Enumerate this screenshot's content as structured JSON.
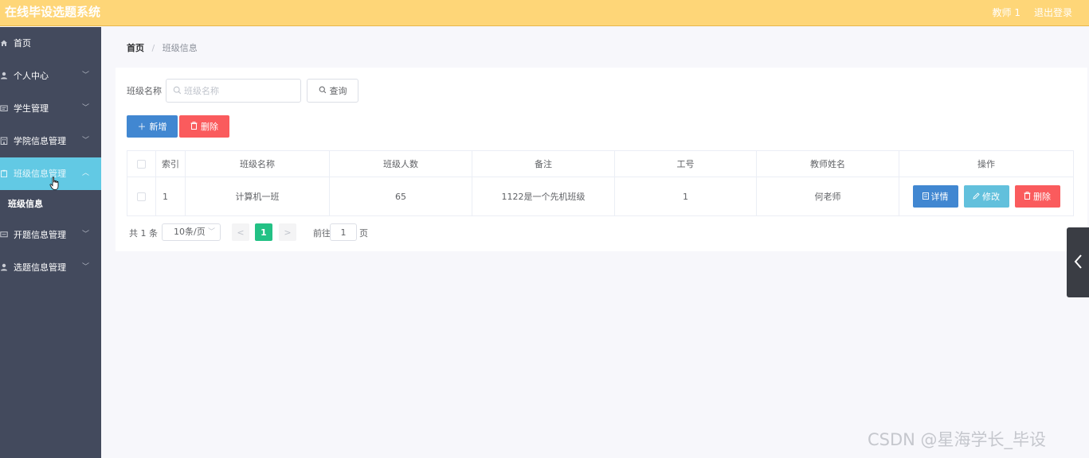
{
  "header": {
    "app_title": "在线毕设选题系统",
    "user": "教师 1",
    "logout": "退出登录"
  },
  "sidebar": {
    "items": [
      {
        "label": "首页",
        "icon": "home-icon",
        "arrow": ""
      },
      {
        "label": "个人中心",
        "icon": "user-icon",
        "arrow": "﹀"
      },
      {
        "label": "学生管理",
        "icon": "id-card-icon",
        "arrow": "﹀"
      },
      {
        "label": "学院信息管理",
        "icon": "building-icon",
        "arrow": "﹀"
      },
      {
        "label": "班级信息管理",
        "icon": "clipboard-icon",
        "arrow": "︿"
      },
      {
        "label": "开题信息管理",
        "icon": "message-icon",
        "arrow": "﹀"
      },
      {
        "label": "选题信息管理",
        "icon": "person-icon",
        "arrow": "﹀"
      }
    ],
    "sub_item": "班级信息"
  },
  "breadcrumb": {
    "home": "首页",
    "separator": "/",
    "current": "班级信息"
  },
  "search": {
    "label": "班级名称",
    "placeholder": "班级名称",
    "query_button": "查询"
  },
  "actions": {
    "add": "新增",
    "delete": "删除"
  },
  "table": {
    "columns": [
      "",
      "索引",
      "班级名称",
      "班级人数",
      "备注",
      "工号",
      "教师姓名",
      "操作"
    ],
    "rows": [
      {
        "index": "1",
        "class_name": "计算机一班",
        "count": "65",
        "remark": "1122是一个先机班级",
        "job_no": "1",
        "teacher": "何老师"
      }
    ],
    "row_actions": {
      "detail": "详情",
      "edit": "修改",
      "delete": "删除"
    }
  },
  "pagination": {
    "total": "共 1 条",
    "page_size": "10条/页",
    "prev": "<",
    "current": "1",
    "next": ">",
    "goto_label": "前往",
    "goto_value": "1",
    "page_label": "页"
  },
  "watermark": "CSDN @星海学长_毕设",
  "colors": {
    "topbar": "#fed678",
    "sidebar": "#434a5d",
    "active_menu": "#62c9e4",
    "primary": "#4187d1",
    "danger": "#fa5b5d",
    "info": "#62c0dc",
    "success": "#23c185"
  }
}
